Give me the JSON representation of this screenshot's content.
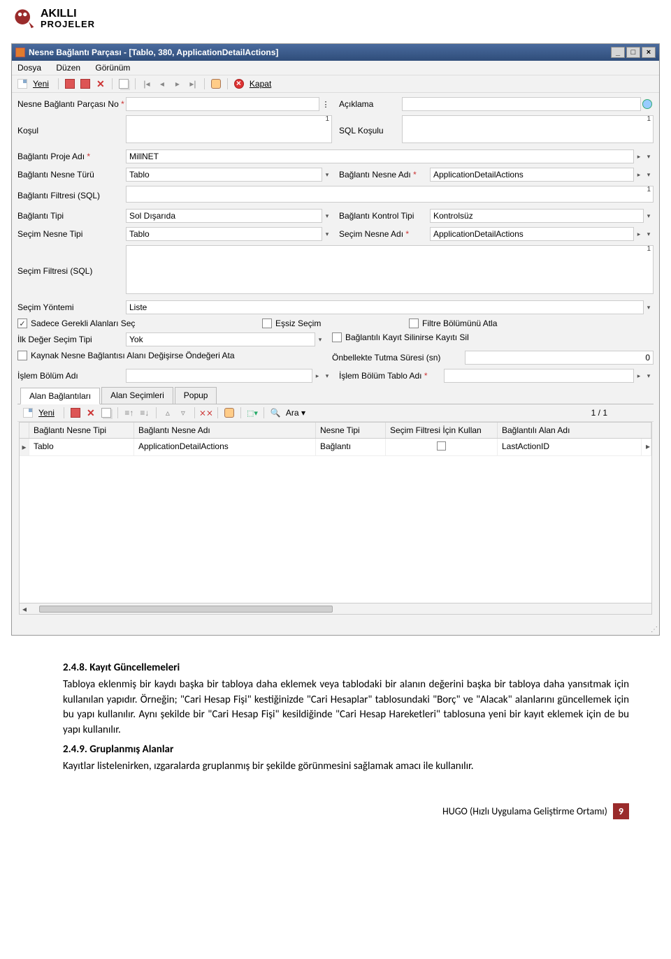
{
  "logo": {
    "line1": "AKILLI",
    "line2": "PROJELER"
  },
  "window": {
    "title": "Nesne Bağlantı Parçası - [Tablo, 380, ApplicationDetailActions]"
  },
  "menu": {
    "file": "Dosya",
    "edit": "Düzen",
    "view": "Görünüm"
  },
  "toolbar": {
    "new": "Yeni",
    "close": "Kapat"
  },
  "form": {
    "no_label": "Nesne Bağlantı Parçası No",
    "no_value": "",
    "desc_label": "Açıklama",
    "desc_value": "",
    "kosul_label": "Koşul",
    "kosul_num": "1",
    "sql_kosul_label": "SQL Koşulu",
    "sql_kosul_num": "1",
    "proje_label": "Bağlantı Proje Adı",
    "proje_value": "MillNET",
    "nesne_turu_label": "Bağlantı Nesne Türü",
    "nesne_turu_value": "Tablo",
    "nesne_adi_label": "Bağlantı Nesne Adı",
    "nesne_adi_value": "ApplicationDetailActions",
    "filtre_label": "Bağlantı Filtresi (SQL)",
    "filtre_num": "1",
    "baglanti_tipi_label": "Bağlantı Tipi",
    "baglanti_tipi_value": "Sol Dışarıda",
    "kontrol_tipi_label": "Bağlantı Kontrol Tipi",
    "kontrol_tipi_value": "Kontrolsüz",
    "secim_nesne_tipi_label": "Seçim Nesne Tipi",
    "secim_nesne_tipi_value": "Tablo",
    "secim_nesne_adi_label": "Seçim Nesne Adı",
    "secim_nesne_adi_value": "ApplicationDetailActions",
    "secim_filtre_label": "Seçim Filtresi (SQL)",
    "secim_filtre_num": "1",
    "secim_yontemi_label": "Seçim Yöntemi",
    "secim_yontemi_value": "Liste",
    "chk_gerekli": "Sadece Gerekli Alanları Seç",
    "chk_essiz": "Eşsiz Seçim",
    "chk_filtre_atla": "Filtre Bölümünü Atla",
    "ilk_deger_label": "İlk Değer Seçim Tipi",
    "ilk_deger_value": "Yok",
    "chk_silinirse": "Bağlantılı Kayıt Silinirse Kayıtı Sil",
    "chk_ondeger": "Kaynak Nesne Bağlantısı Alanı Değişirse Öndeğeri Ata",
    "onbellek_label": "Önbellekte Tutma Süresi (sn)",
    "onbellek_value": "0",
    "islem_bolum_label": "İşlem Bölüm Adı",
    "islem_tablo_label": "İşlem Bölüm Tablo Adı"
  },
  "tabs": {
    "t1": "Alan Bağlantıları",
    "t2": "Alan Seçimleri",
    "t3": "Popup"
  },
  "subtoolbar": {
    "new": "Yeni",
    "search": "Ara",
    "page": "1 / 1"
  },
  "grid": {
    "h1": "Bağlantı Nesne Tipi",
    "h2": "Bağlantı Nesne Adı",
    "h3": "Nesne Tipi",
    "h4": "Seçim Filtresi İçin Kullan",
    "h5": "Bağlantılı Alan Adı",
    "r1c1": "Tablo",
    "r1c2": "ApplicationDetailActions",
    "r1c3": "Bağlantı",
    "r1c4": "",
    "r1c5": "LastActionID"
  },
  "doc": {
    "sec1_num": "2.4.8.",
    "sec1_title": "Kayıt Güncellemeleri",
    "sec1_body": "Tabloya eklenmiş bir kaydı başka bir tabloya daha eklemek veya tablodaki bir alanın değerini başka bir tabloya daha yansıtmak için kullanılan yapıdır. Örneğin; \"Cari Hesap Fişi\" kestiğinizde \"Cari Hesaplar\" tablosundaki \"Borç\" ve \"Alacak\" alanlarını güncellemek için bu yapı kullanılır. Aynı şekilde bir \"Cari Hesap Fişi\" kesildiğinde \"Cari Hesap Hareketleri\" tablosuna yeni bir kayıt eklemek için de bu yapı kullanılır.",
    "sec2_num": "2.4.9.",
    "sec2_title": "Gruplanmış Alanlar",
    "sec2_body": "Kayıtlar listelenirken, ızgaralarda gruplanmış bir şekilde görünmesini sağlamak amacı ile kullanılır."
  },
  "footer": {
    "text": "HUGO (Hızlı Uygulama Geliştirme Ortamı)",
    "page": "9"
  }
}
